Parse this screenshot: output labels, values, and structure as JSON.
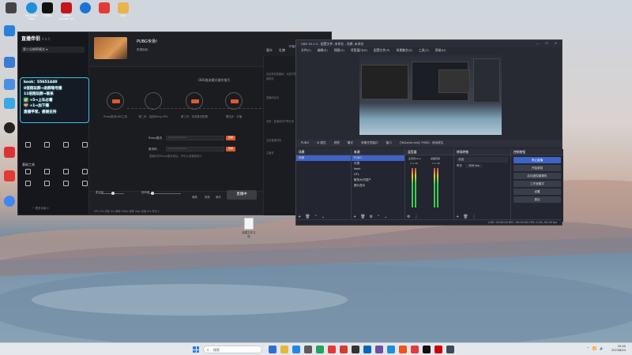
{
  "desktop": {
    "icons": [
      {
        "label": "",
        "color": "#444"
      },
      {
        "label": "Microsoft Edge",
        "color": "#1d8fdc"
      },
      {
        "label": "TikTok",
        "color": "#111"
      },
      {
        "label": "Adobe Acrobat DC",
        "color": "#c4151c"
      },
      {
        "label": "",
        "color": "#1b74d4"
      },
      {
        "label": "",
        "color": "#e53935"
      },
      {
        "label": "Qbs",
        "color": "#e8b44c"
      }
    ],
    "left_icons": [
      {
        "color": "#2c7fdc"
      },
      {
        "color": "#3a7bd5"
      },
      {
        "color": "#4a90e2"
      },
      {
        "color": "#3aa8e6"
      },
      {
        "color": "#222"
      },
      {
        "color": "#d33"
      },
      {
        "color": "#e53935"
      },
      {
        "color": "#4285f4"
      }
    ],
    "file_label": "新建文本文档"
  },
  "live": {
    "app_name": "直播伴侣",
    "version": "9.4.5",
    "scene_select": "第二分辨率模式 ▾",
    "overlay_lines": [
      "kook：55651440",
      "8倍陪玩群→进群暗号播",
      "11倍陪玩群→联系",
      "✅ +5→上车必看",
      "💝 +1→加下播",
      "直播平常，感谢支持"
    ],
    "tools": [
      [
        "",
        "",
        "",
        ""
      ],
      [
        "",
        "",
        "",
        ""
      ],
      [
        "",
        "",
        "",
        ""
      ]
    ],
    "tools_title": "基础工具",
    "tools_row2": [
      "",
      "",
      "",
      ""
    ],
    "footer": "一 更多功能 ▾",
    "stream_title": "PUBG专场！",
    "stream_sub": "数据面板",
    "stream_badge": "开播",
    "top_right": [
      "开播指南",
      "在线 0",
      "点赞 0"
    ],
    "flow_title": "OBS推流模式操作指引",
    "nodes": [
      {
        "label": "Rtmp推流OBS工具"
      },
      {
        "label": "第二步：复制Rtmp URL"
      },
      {
        "label": "第三步：完成推流配置"
      },
      {
        "label": "第四步：开播"
      }
    ],
    "form": [
      {
        "label": "Rtmp推流",
        "value": "**************",
        "btn": "复制"
      },
      {
        "label": "推流码",
        "value": "**************",
        "btn": "复制"
      }
    ],
    "hint": "直播中的Rtmp推流地址，不可以泄漏给他人",
    "bottom_labels": [
      "麦克风",
      "扬声器",
      "美颜",
      "特效",
      "音乐"
    ],
    "go_live": "直播中",
    "status": "CPU 0% 内存 0% 网络 0KB/s 帧率 0fps 丢帧 0% 时长 0",
    "rp_tabs": [
      "观众",
      "礼物"
    ],
    "rp_texts": [
      "欢迎来到直播间，请遵守直播规范",
      "直播间互动",
      "系统：直播间内严禁引流",
      "当前直播内容",
      "主播说"
    ]
  },
  "obs": {
    "title": "OBS 29.1.3 - 配置文件: 未命名 - 场景: 未命名",
    "menu": [
      "文件(F)",
      "编辑(E)",
      "视图(V)",
      "停靠窗口(D)",
      "配置文件(P)",
      "场景集合(S)",
      "工具(T)",
      "帮助(H)"
    ],
    "toolbar": [
      "PUBG",
      "⚙ 属性",
      "滤镜",
      "模式",
      "采集任意窗口",
      "窗口",
      "[TslGame.exe]: PUBG：绝地求生"
    ],
    "docks": {
      "scenes": {
        "title": "场景",
        "items": [
          "场景"
        ]
      },
      "sources": {
        "title": "来源",
        "items": [
          "PUBG",
          "礼物",
          "kook",
          "UTL",
          "服务大厅国产",
          "图片显示"
        ]
      },
      "mixer": {
        "title": "混音器",
        "channels": [
          "麦克风/Aux",
          "桌面音频"
        ],
        "levels": [
          "0.0 dB",
          "0.0 dB"
        ]
      },
      "transitions": {
        "title": "转场特效",
        "type": "淡出",
        "duration_label": "时长",
        "duration": "300 ms"
      },
      "controls": {
        "title": "控制按钮",
        "buttons": [
          "停止直播",
          "开始录制",
          "启动虚拟摄像机",
          "工作室模式",
          "设置",
          "退出"
        ]
      }
    },
    "status": "LIVE: 00:00:00  REC: 00:00:00  CPU: 0.0%, 60.00 fps"
  },
  "taskbar": {
    "search_placeholder": "搜索",
    "icons": [
      "#2d6fd6",
      "#e8b63b",
      "#1e88e5",
      "#5c5c5c",
      "#20a35a",
      "#e53935",
      "#d63d2c",
      "#333333",
      "#0067c0",
      "#6d4fa3",
      "#1d8fdc",
      "#f4511e",
      "#e23b3b",
      "#111111",
      "#cc0000",
      "#3e4a59"
    ],
    "time": "20:40",
    "date": "2023/8/24"
  }
}
